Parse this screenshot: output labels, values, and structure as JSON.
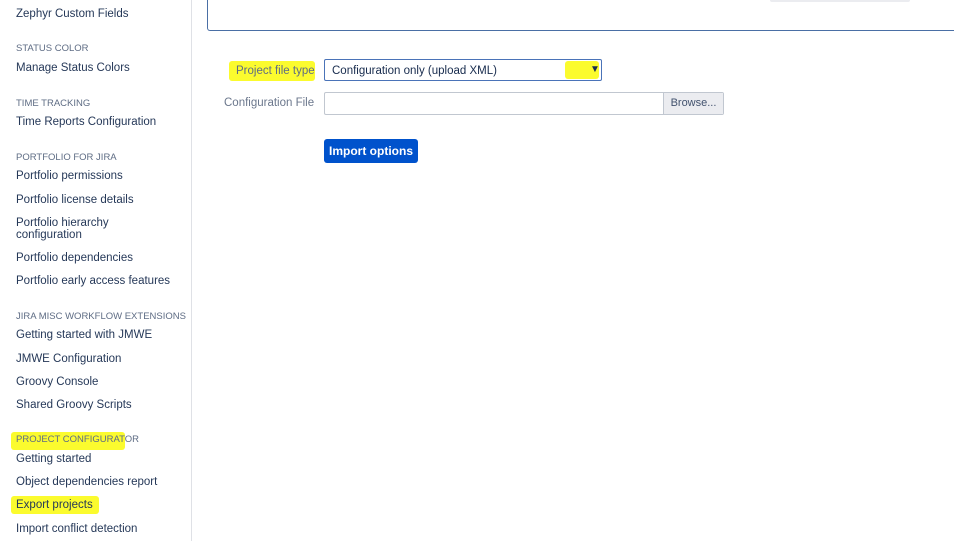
{
  "sidebar": {
    "top_link": "Zephyr Custom Fields",
    "sections": [
      {
        "heading": "STATUS COLOR",
        "links": [
          "Manage Status Colors"
        ]
      },
      {
        "heading": "TIME TRACKING",
        "links": [
          "Time Reports Configuration"
        ]
      },
      {
        "heading": "PORTFOLIO FOR JIRA",
        "links": [
          "Portfolio permissions",
          "Portfolio license details",
          "Portfolio hierarchy configuration",
          "Portfolio dependencies",
          "Portfolio early access features"
        ]
      },
      {
        "heading": "JIRA MISC WORKFLOW EXTENSIONS",
        "links": [
          "Getting started with JMWE",
          "JMWE Configuration",
          "Groovy Console",
          "Shared Groovy Scripts"
        ]
      },
      {
        "heading": "PROJECT CONFIGURATOR",
        "links": [
          "Getting started",
          "Object dependencies report",
          "Export projects",
          "Import conflict detection"
        ]
      }
    ]
  },
  "form": {
    "project_file_type_label": "Project file type",
    "project_file_type_value": "Configuration only (upload XML)",
    "configuration_file_label": "Configuration File",
    "browse_label": "Browse...",
    "import_button": "Import options"
  },
  "colors": {
    "highlight": "#fbfb2e",
    "primary_button": "#0052cc"
  },
  "icons": {
    "select_arrow": "chevron-down-icon"
  }
}
